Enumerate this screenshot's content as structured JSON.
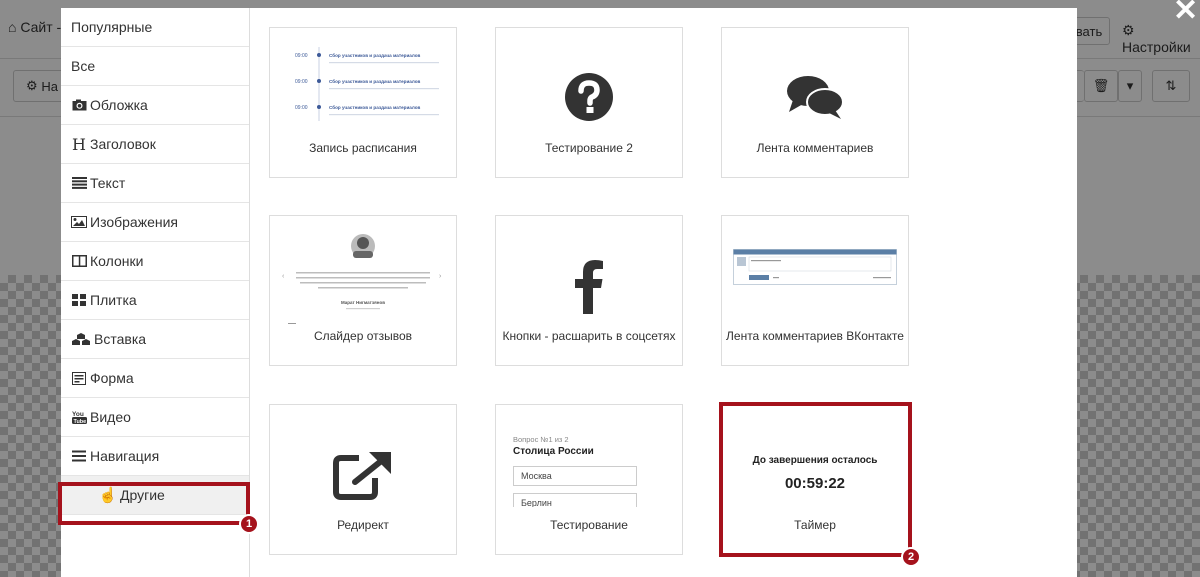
{
  "background": {
    "site_label": "Сайт -",
    "tab_label": "На",
    "save_label": "вать",
    "settings_label": "Настройки",
    "delete_icon": "trash-icon",
    "sort_icon": "sort-icon"
  },
  "close_label": "✕",
  "sidebar": {
    "items": [
      {
        "label": "Популярные",
        "icon": ""
      },
      {
        "label": "Все",
        "icon": ""
      },
      {
        "label": "Обложка",
        "icon": "camera-icon"
      },
      {
        "label": "Заголовок",
        "icon": "header-icon"
      },
      {
        "label": "Текст",
        "icon": "align-justify-icon"
      },
      {
        "label": "Изображения",
        "icon": "image-icon"
      },
      {
        "label": "Колонки",
        "icon": "columns-icon"
      },
      {
        "label": "Плитка",
        "icon": "th-large-icon"
      },
      {
        "label": "Вставка",
        "icon": "cubes-icon"
      },
      {
        "label": "Форма",
        "icon": "form-icon"
      },
      {
        "label": "Видео",
        "icon": "youtube-icon"
      },
      {
        "label": "Навигация",
        "icon": "bars-icon"
      },
      {
        "label": "Другие",
        "icon": "hand-icon"
      }
    ],
    "active_index": 12
  },
  "blocks": [
    {
      "label": "Запись расписания",
      "preview": "schedule"
    },
    {
      "label": "Тестирование 2",
      "preview": "question-icon"
    },
    {
      "label": "Лента комментариев",
      "preview": "comments-icon"
    },
    {
      "label": "Слайдер отзывов",
      "preview": "reviews"
    },
    {
      "label": "Кнопки - расшарить в соцсетях",
      "preview": "facebook-icon"
    },
    {
      "label": "Лента комментариев ВКонтакте",
      "preview": "vk"
    },
    {
      "label": "Редирект",
      "preview": "external-link-icon"
    },
    {
      "label": "Тестирование",
      "preview": "quiz"
    },
    {
      "label": "Таймер",
      "preview": "timer"
    }
  ],
  "schedule_preview": {
    "times": [
      "09:00",
      "09:00",
      "09:00"
    ],
    "title": "Сбор участников и раздача материалов"
  },
  "review_preview": {
    "name": "Марат Нигматзянов"
  },
  "quiz_preview": {
    "counter": "Вопрос №1 из 2",
    "question": "Столица России",
    "options": [
      "Москва",
      "Берлин"
    ]
  },
  "timer_preview": {
    "heading": "До завершения осталось",
    "time": "00:59:22"
  },
  "annotations": {
    "badge1": "1",
    "badge2": "2",
    "color": "#a5121c"
  }
}
